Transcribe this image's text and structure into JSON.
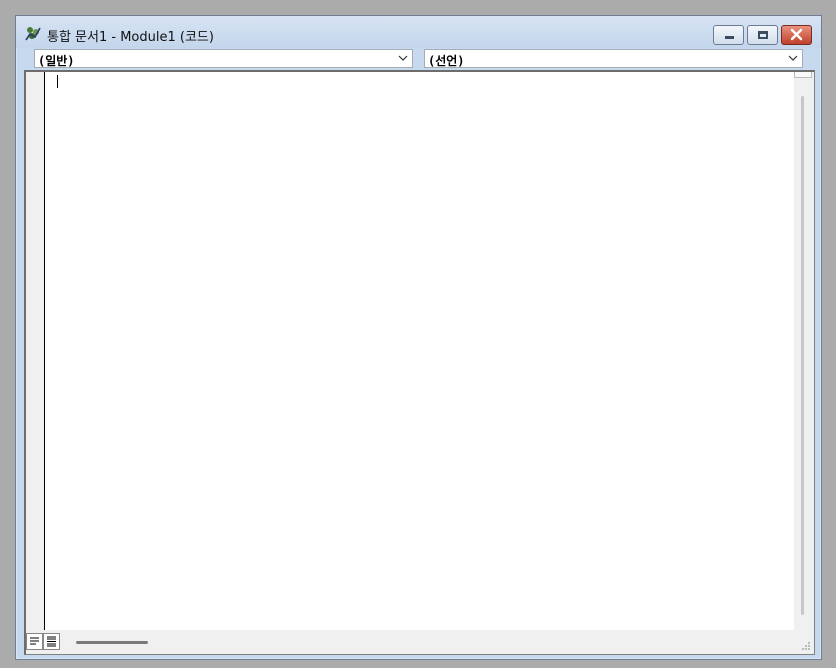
{
  "window": {
    "title": "통합 문서1 - Module1 (코드)",
    "app_icon": "vba-module-icon"
  },
  "title_buttons": {
    "minimize_icon": "minimize-icon",
    "maximize_icon": "maximize-icon",
    "close_icon": "close-icon"
  },
  "combos": {
    "object_value": "(일반)",
    "procedure_value": "(선언)"
  },
  "editor": {
    "code_text": ""
  },
  "view_buttons": {
    "procedure_view_icon": "procedure-view-icon",
    "full_module_view_icon": "full-module-view-icon"
  },
  "colors": {
    "titlebar": "#c4d6ec",
    "close_button": "#c0402a",
    "editor_background": "#ffffff"
  }
}
